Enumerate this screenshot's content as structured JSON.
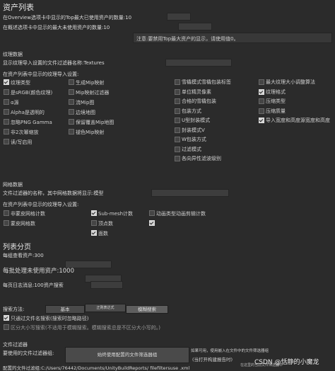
{
  "title": "资产列表",
  "overview_topn": {
    "label": "在Overview选项卡中显示的Top最大已使用资产的数量:10"
  },
  "summary_topn": {
    "label": "在概述选项卡中显示的最大未使用资产的数量:10"
  },
  "note": "注意:要禁用Top最大资产的显示，请使用值0。",
  "texture_section": {
    "header": "纹理数据",
    "filter_label": "显示纹理导入设置的文件过滤器名称:Textures",
    "import_header": "在资产列表中显示的纹理导入设置:",
    "col1": [
      {
        "label": "纹理类型",
        "checked": true
      },
      {
        "label": "是sRGB(颜色纹理)",
        "checked": false
      },
      {
        "label": "α源",
        "checked": false
      },
      {
        "label": "Alpha是透明的",
        "checked": false
      },
      {
        "label": "忽略PNG Gamma",
        "checked": false
      },
      {
        "label": "非2次幂缩放",
        "checked": false
      },
      {
        "label": "读/写启用",
        "checked": false
      }
    ],
    "col2": [
      {
        "label": "生成Mip映射",
        "checked": false
      },
      {
        "label": "Mip映射过滤器",
        "checked": false
      },
      {
        "label": "流Mip图",
        "checked": false
      },
      {
        "label": "边境地图",
        "checked": false
      },
      {
        "label": "保留覆盖Mip地图",
        "checked": false
      },
      {
        "label": "褪色Mip映射",
        "checked": false
      }
    ],
    "col3": [
      {
        "label": "雪橇模式雪橇包装标签",
        "checked": false
      },
      {
        "label": "单位精灵像素",
        "checked": false
      },
      {
        "label": "合格的雪橇包装",
        "checked": false
      },
      {
        "label": "包装方式",
        "checked": false
      },
      {
        "label": "U型封装模式",
        "checked": false
      },
      {
        "label": "封装模式V",
        "checked": false
      },
      {
        "label": "W包装方式",
        "checked": false
      },
      {
        "label": "过滤模式",
        "checked": false
      },
      {
        "label": "各向异性滤波级别",
        "checked": false
      }
    ],
    "col4": [
      {
        "label": "最大纹理大小调整算法",
        "checked": false
      },
      {
        "label": "纹理格式",
        "checked": true
      },
      {
        "label": "压缩类型",
        "checked": false
      },
      {
        "label": "压缩质量",
        "checked": false
      },
      {
        "label": "导入宽度和高度源宽度和高度",
        "checked": true
      }
    ]
  },
  "mesh_section": {
    "header": "网格数据",
    "filter_label": "文件过滤器的名称，其中网格数据将显示:模型",
    "import_header": "在资产列表中显示的纹理导入设置:",
    "col1": [
      {
        "label": "非蒙皮网格计数",
        "checked": false
      },
      {
        "label": "蒙皮网格数",
        "checked": false
      }
    ],
    "col2": [
      {
        "label": "Sub-mesh计数",
        "checked": true
      },
      {
        "label": "顶点数",
        "checked": false
      },
      {
        "label": "面数",
        "checked": true
      }
    ],
    "col3": [
      {
        "label": "动画类型动画剪辑计数",
        "checked": false
      },
      {
        "label": "",
        "checked": true
      }
    ]
  },
  "paging": {
    "header": "列表分页",
    "per_group": "每组查看资产:300",
    "per_batch": "每批处理未使用资产:1000",
    "per_page_log": "每页日志消息:100资产搜索"
  },
  "search": {
    "label": "搜索方法:",
    "buttons": [
      "基本",
      "正则表达式",
      "模糊搜索"
    ],
    "filter_names": "只通过文件名搜索(搜索时忽略路径)",
    "case_sensitive": "区分大小写搜索(不适用于模糊搜索。模糊搜索总是不区分大小写的。)"
  },
  "file_filter": {
    "header": "文件过滤器",
    "to_use_label": "要使用的文件过滤器组:",
    "use_config_button": "始终使用配置的文件筛选器组",
    "side_text": "如果可用，使用嵌入在文件中的文件筛选器组",
    "side_text2": "(当打开构建报告时)",
    "side_text3": "在这里的当前文件筛选器中",
    "path_label": "配置的文件过滤组:C:/Users/76442/Documents/UnityBuildReports/ filefiltersuse .xml"
  },
  "watermark": "CSDN @恬静的小魔龙"
}
